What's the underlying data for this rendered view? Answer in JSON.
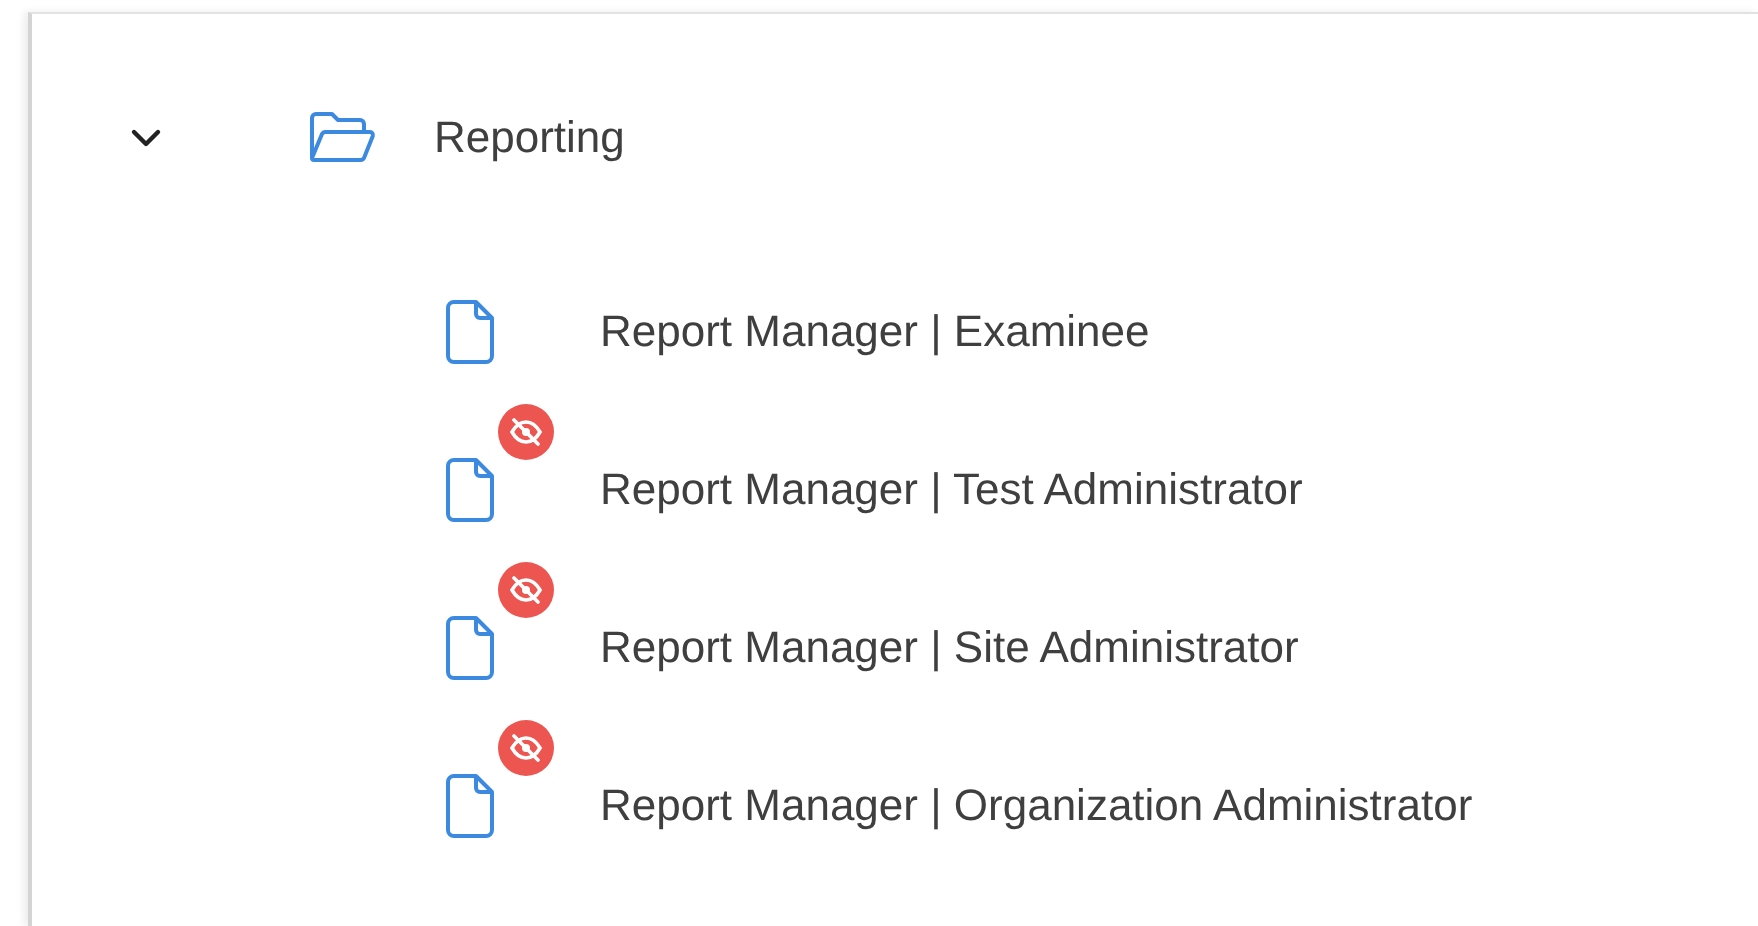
{
  "tree": [
    {
      "label": "Reporting",
      "expanded": true,
      "children": [
        {
          "label": "Report Manager | Examinee",
          "hidden": false
        },
        {
          "label": "Report Manager | Test Administrator",
          "hidden": true
        },
        {
          "label": "Report Manager | Site Administrator",
          "hidden": true
        },
        {
          "label": "Report Manager | Organization Administrator",
          "hidden": true
        }
      ]
    }
  ]
}
